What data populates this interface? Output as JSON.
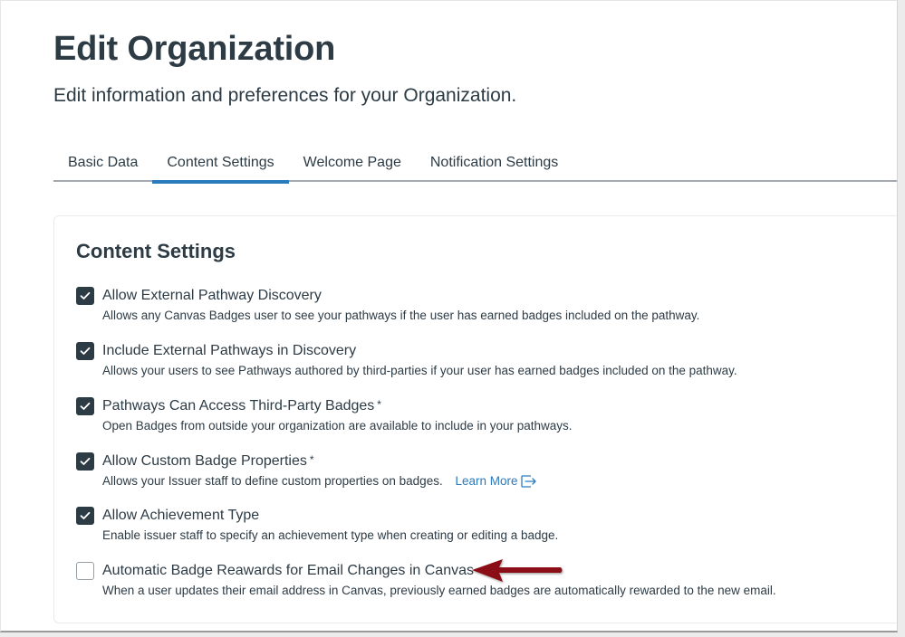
{
  "header": {
    "title": "Edit Organization",
    "subtitle": "Edit information and preferences for your Organization."
  },
  "tabs": [
    {
      "label": "Basic Data",
      "active": false
    },
    {
      "label": "Content Settings",
      "active": true
    },
    {
      "label": "Welcome Page",
      "active": false
    },
    {
      "label": "Notification Settings",
      "active": false
    }
  ],
  "content_settings": {
    "title": "Content Settings",
    "settings": [
      {
        "label": "Allow External Pathway Discovery",
        "required_marker": "",
        "description": "Allows any Canvas Badges user to see your pathways if the user has earned badges included on the pathway.",
        "checked": true
      },
      {
        "label": "Include External Pathways in Discovery",
        "required_marker": "",
        "description": "Allows your users to see Pathways authored by third-parties if your user has earned badges included on the pathway.",
        "checked": true
      },
      {
        "label": "Pathways Can Access Third-Party Badges",
        "required_marker": "*",
        "description": "Open Badges from outside your organization are available to include in your pathways.",
        "checked": true
      },
      {
        "label": "Allow Custom Badge Properties",
        "required_marker": "*",
        "description": "Allows your Issuer staff to define custom properties on badges.",
        "link_label": "Learn More",
        "link_icon": "external-link-icon",
        "checked": true
      },
      {
        "label": "Allow Achievement Type",
        "required_marker": "",
        "description": "Enable issuer staff to specify an achievement type when creating or editing a badge.",
        "checked": true
      },
      {
        "label": "Automatic Badge Reawards for Email Changes in Canvas",
        "required_marker": "",
        "description": "When a user updates their email address in Canvas, previously earned badges are automatically rewarded to the new email.",
        "checked": false
      }
    ]
  },
  "annotation": {
    "icon": "arrow-left-icon",
    "color": "#8b0f14"
  },
  "colors": {
    "text": "#2d3b45",
    "accent": "#2b7abc",
    "checkbox_checked": "#2d3b45"
  }
}
